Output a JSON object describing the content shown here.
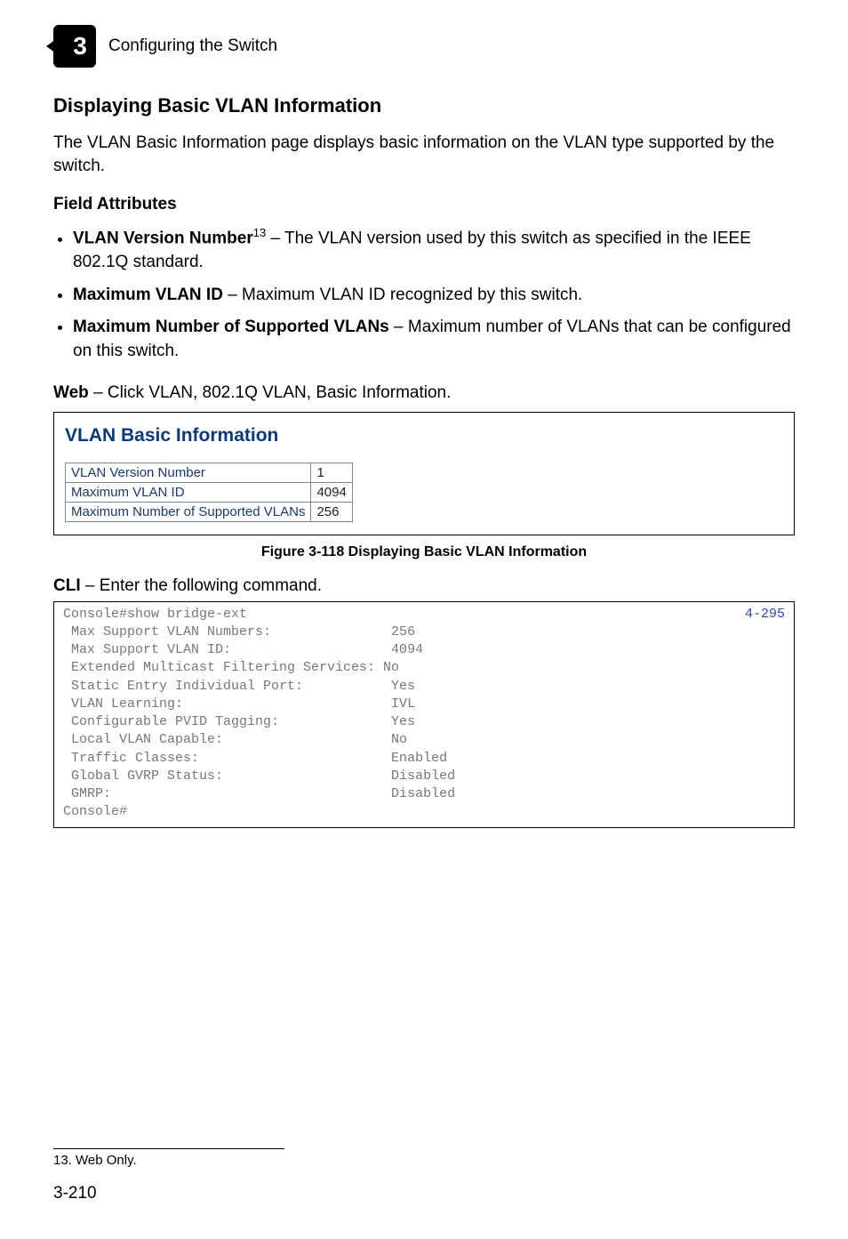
{
  "header": {
    "chapter_number": "3",
    "title": "Configuring the Switch"
  },
  "section": {
    "heading": "Displaying Basic VLAN Information",
    "intro": "The VLAN Basic Information page displays basic information on the VLAN type supported by the switch."
  },
  "field_attributes": {
    "heading": "Field Attributes",
    "items": [
      {
        "term": "VLAN Version Number",
        "sup": "13",
        "desc": " – The VLAN version used by this switch as specified in the IEEE 802.1Q standard."
      },
      {
        "term": "Maximum VLAN ID",
        "sup": "",
        "desc": " – Maximum VLAN ID recognized by this switch."
      },
      {
        "term": "Maximum Number of Supported VLANs",
        "sup": "",
        "desc": " – Maximum number of VLANs that can be configured on this switch."
      }
    ]
  },
  "web": {
    "label": "Web",
    "text": " – Click VLAN, 802.1Q VLAN, Basic Information."
  },
  "panel": {
    "title": "VLAN Basic Information",
    "rows": [
      {
        "label": "VLAN Version Number",
        "value": "1"
      },
      {
        "label": "Maximum VLAN ID",
        "value": "4094"
      },
      {
        "label": "Maximum Number of Supported VLANs",
        "value": "256"
      }
    ]
  },
  "figure_caption": "Figure 3-118  Displaying Basic VLAN Information",
  "cli": {
    "label": "CLI",
    "intro": " – Enter the following command.",
    "ref": "4-295",
    "lines": [
      "Console#show bridge-ext",
      " Max Support VLAN Numbers:               256",
      " Max Support VLAN ID:                    4094",
      " Extended Multicast Filtering Services: No",
      " Static Entry Individual Port:           Yes",
      " VLAN Learning:                          IVL",
      " Configurable PVID Tagging:              Yes",
      " Local VLAN Capable:                     No",
      " Traffic Classes:                        Enabled",
      " Global GVRP Status:                     Disabled",
      " GMRP:                                   Disabled",
      "Console#"
    ]
  },
  "footnote": "13. Web Only.",
  "page_number": "3-210"
}
